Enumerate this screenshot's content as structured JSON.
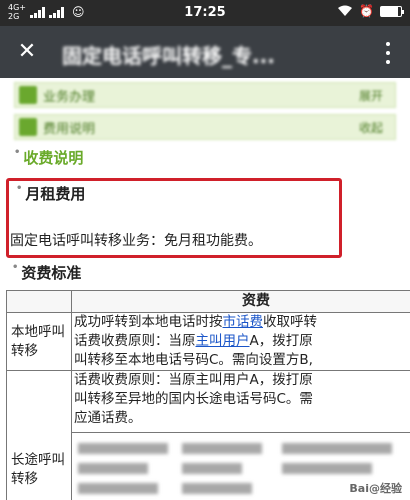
{
  "status_bar": {
    "network_top": "4G+",
    "network_bottom": "2G",
    "time": "17:25",
    "battery_level": 0.85
  },
  "title_bar": {
    "title": "固定电话呼叫转移_专..."
  },
  "menu": [
    {
      "label": "业务办理",
      "right": "展开"
    },
    {
      "label": "费用说明",
      "right": "收起"
    }
  ],
  "sections": {
    "charge_title": "收费说明",
    "monthly_fee_title": "月租费用",
    "monthly_fee_text": "固定电话呼叫转移业务：免月租功能费。",
    "standard_title": "资费标准"
  },
  "table": {
    "fee_header": "资费",
    "rows": [
      {
        "name": "本地呼叫转移",
        "lines": [
          [
            "成功呼转到本地电话时按",
            "市话费",
            "收取呼转"
          ],
          [
            "话费收费原则：当原",
            "主叫用户",
            "A，拨打原"
          ],
          [
            "叫转移至本地电话号码C。需向设置方B,"
          ]
        ]
      },
      {
        "name": "长途呼叫转移",
        "lines": [
          [
            "话费收费原则：当原主叫用户A，拨打原"
          ],
          [
            "叫转移至异地的国内长途电话号码C。需"
          ],
          [
            "应通话费。"
          ]
        ]
      }
    ]
  },
  "watermark": "Bai@经验",
  "colors": {
    "status_bar_bg": "#2a2a2a",
    "title_bar_bg": "#3b3f44",
    "section_green": "#6aaa2a",
    "highlight_red": "#d0202a",
    "link_blue": "#1a55c8"
  },
  "icons": [
    "close-icon",
    "more-icon",
    "wifi-icon",
    "alarm-icon",
    "battery-icon",
    "signal-icon"
  ]
}
